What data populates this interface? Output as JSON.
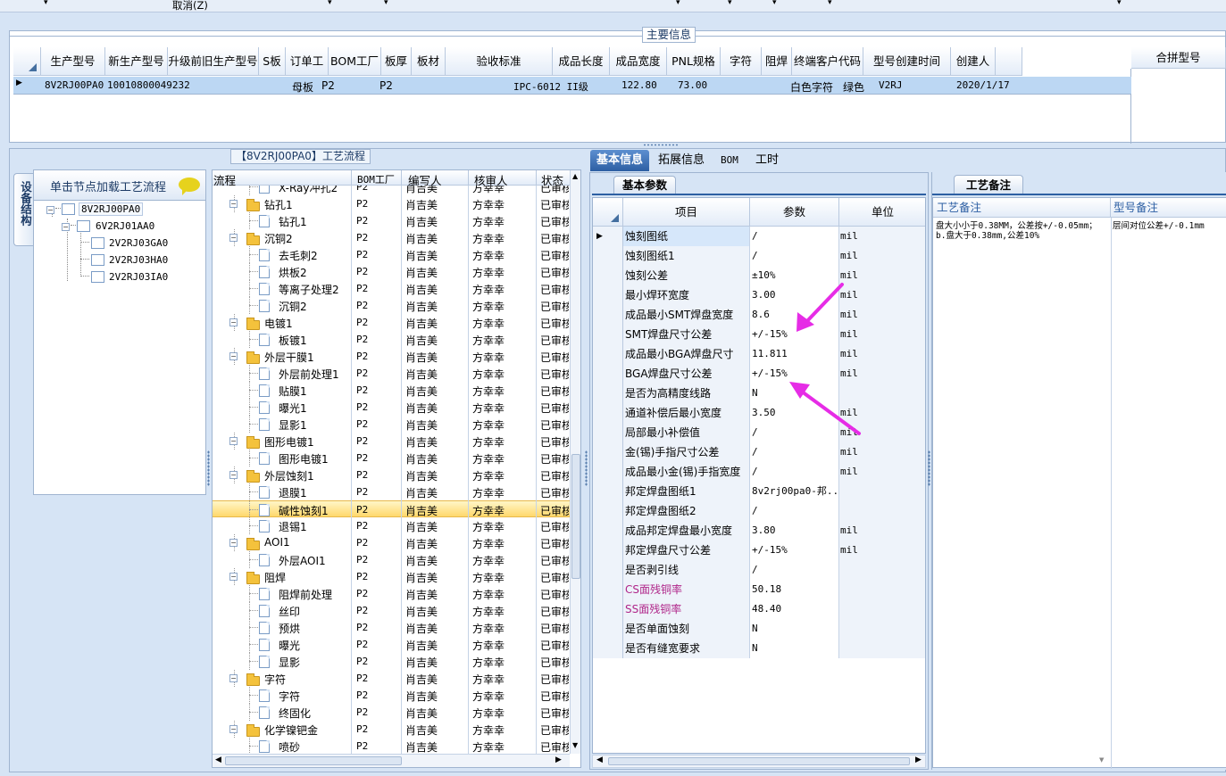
{
  "toolbar": {
    "cancel_label": "取消(Z)"
  },
  "main_info": {
    "title": "主要信息",
    "columns": [
      "生产型号",
      "新生产型号",
      "升级前旧生产型号",
      "S板",
      "订单工厂",
      "BOM工厂",
      "板厚",
      "板材",
      "验收标准",
      "成品长度",
      "成品宽度",
      "PNL规格",
      "字符",
      "阻焊",
      "终端客户代码",
      "型号创建时间",
      "创建人"
    ],
    "merge_col": "合拼型号",
    "row": {
      "prod_no": "8V2RJ00PA0",
      "new_prod_no": "10010800049232",
      "s_board": "母板",
      "order_factory": "P2",
      "bom_factory": "P2",
      "standard": "IPC-6012 II级",
      "length": "122.80",
      "width": "73.00",
      "char": "白色字符",
      "solder": "绿色",
      "customer": "V2RJ",
      "created": "2020/1/17"
    }
  },
  "device_panel": {
    "side_tab": "设备结构",
    "title": "单击节点加载工艺流程",
    "nodes": [
      "8V2RJ00PA0",
      "6V2RJ01AA0",
      "2V2RJ03GA0",
      "2V2RJ03HA0",
      "2V2RJ03IA0"
    ]
  },
  "process": {
    "title": "【8V2RJ00PA0】工艺流程",
    "columns": [
      "流程",
      "BOM工厂",
      "编写人",
      "核审人",
      "状态"
    ],
    "rows": [
      {
        "type": "doc",
        "name": "X-Ray冲孔2",
        "bom": "P2",
        "writer": "肖吉美",
        "reviewer": "方幸幸",
        "status": "已审核"
      },
      {
        "type": "folder",
        "name": "钻孔1",
        "bom": "P2",
        "writer": "肖吉美",
        "reviewer": "方幸幸",
        "status": "已审核"
      },
      {
        "type": "doc",
        "name": "钻孔1",
        "bom": "P2",
        "writer": "肖吉美",
        "reviewer": "方幸幸",
        "status": "已审核"
      },
      {
        "type": "folder",
        "name": "沉铜2",
        "bom": "P2",
        "writer": "肖吉美",
        "reviewer": "方幸幸",
        "status": "已审核"
      },
      {
        "type": "doc",
        "name": "去毛刺2",
        "bom": "P2",
        "writer": "肖吉美",
        "reviewer": "方幸幸",
        "status": "已审核"
      },
      {
        "type": "doc",
        "name": "烘板2",
        "bom": "P2",
        "writer": "肖吉美",
        "reviewer": "方幸幸",
        "status": "已审核"
      },
      {
        "type": "doc",
        "name": "等离子处理2",
        "bom": "P2",
        "writer": "肖吉美",
        "reviewer": "方幸幸",
        "status": "已审核"
      },
      {
        "type": "doc",
        "name": "沉铜2",
        "bom": "P2",
        "writer": "肖吉美",
        "reviewer": "方幸幸",
        "status": "已审核"
      },
      {
        "type": "folder",
        "name": "电镀1",
        "bom": "P2",
        "writer": "肖吉美",
        "reviewer": "方幸幸",
        "status": "已审核"
      },
      {
        "type": "doc",
        "name": "板镀1",
        "bom": "P2",
        "writer": "肖吉美",
        "reviewer": "方幸幸",
        "status": "已审核"
      },
      {
        "type": "folder",
        "name": "外层干膜1",
        "bom": "P2",
        "writer": "肖吉美",
        "reviewer": "方幸幸",
        "status": "已审核"
      },
      {
        "type": "doc",
        "name": "外层前处理1",
        "bom": "P2",
        "writer": "肖吉美",
        "reviewer": "方幸幸",
        "status": "已审核"
      },
      {
        "type": "doc",
        "name": "贴膜1",
        "bom": "P2",
        "writer": "肖吉美",
        "reviewer": "方幸幸",
        "status": "已审核"
      },
      {
        "type": "doc",
        "name": "曝光1",
        "bom": "P2",
        "writer": "肖吉美",
        "reviewer": "方幸幸",
        "status": "已审核"
      },
      {
        "type": "doc",
        "name": "显影1",
        "bom": "P2",
        "writer": "肖吉美",
        "reviewer": "方幸幸",
        "status": "已审核"
      },
      {
        "type": "folder",
        "name": "图形电镀1",
        "bom": "P2",
        "writer": "肖吉美",
        "reviewer": "方幸幸",
        "status": "已审核"
      },
      {
        "type": "doc",
        "name": "图形电镀1",
        "bom": "P2",
        "writer": "肖吉美",
        "reviewer": "方幸幸",
        "status": "已审核"
      },
      {
        "type": "folder",
        "name": "外层蚀刻1",
        "bom": "P2",
        "writer": "肖吉美",
        "reviewer": "方幸幸",
        "status": "已审核"
      },
      {
        "type": "doc",
        "name": "退膜1",
        "bom": "P2",
        "writer": "肖吉美",
        "reviewer": "方幸幸",
        "status": "已审核"
      },
      {
        "type": "doc",
        "name": "碱性蚀刻1",
        "bom": "P2",
        "writer": "肖吉美",
        "reviewer": "方幸幸",
        "status": "已审核",
        "selected": true
      },
      {
        "type": "doc",
        "name": "退锡1",
        "bom": "P2",
        "writer": "肖吉美",
        "reviewer": "方幸幸",
        "status": "已审核"
      },
      {
        "type": "folder",
        "name": "AOI1",
        "bom": "P2",
        "writer": "肖吉美",
        "reviewer": "方幸幸",
        "status": "已审核"
      },
      {
        "type": "doc",
        "name": "外层AOI1",
        "bom": "P2",
        "writer": "肖吉美",
        "reviewer": "方幸幸",
        "status": "已审核"
      },
      {
        "type": "folder",
        "name": "阻焊",
        "bom": "P2",
        "writer": "肖吉美",
        "reviewer": "方幸幸",
        "status": "已审核"
      },
      {
        "type": "doc",
        "name": "阻焊前处理",
        "bom": "P2",
        "writer": "肖吉美",
        "reviewer": "方幸幸",
        "status": "已审核"
      },
      {
        "type": "doc",
        "name": "丝印",
        "bom": "P2",
        "writer": "肖吉美",
        "reviewer": "方幸幸",
        "status": "已审核"
      },
      {
        "type": "doc",
        "name": "预烘",
        "bom": "P2",
        "writer": "肖吉美",
        "reviewer": "方幸幸",
        "status": "已审核"
      },
      {
        "type": "doc",
        "name": "曝光",
        "bom": "P2",
        "writer": "肖吉美",
        "reviewer": "方幸幸",
        "status": "已审核"
      },
      {
        "type": "doc",
        "name": "显影",
        "bom": "P2",
        "writer": "肖吉美",
        "reviewer": "方幸幸",
        "status": "已审核"
      },
      {
        "type": "folder",
        "name": "字符",
        "bom": "P2",
        "writer": "肖吉美",
        "reviewer": "方幸幸",
        "status": "已审核"
      },
      {
        "type": "doc",
        "name": "字符",
        "bom": "P2",
        "writer": "肖吉美",
        "reviewer": "方幸幸",
        "status": "已审核"
      },
      {
        "type": "doc",
        "name": "终固化",
        "bom": "P2",
        "writer": "肖吉美",
        "reviewer": "方幸幸",
        "status": "已审核"
      },
      {
        "type": "folder",
        "name": "化学镍钯金",
        "bom": "P2",
        "writer": "肖吉美",
        "reviewer": "方幸幸",
        "status": "已审核"
      },
      {
        "type": "doc",
        "name": "喷砂",
        "bom": "P2",
        "writer": "肖吉美",
        "reviewer": "方幸幸",
        "status": "已审核"
      }
    ]
  },
  "detail": {
    "tabs": [
      "基本信息",
      "拓展信息",
      "BOM",
      "工时"
    ],
    "subtab": "基本参数",
    "columns": [
      "项目",
      "参数",
      "单位"
    ],
    "rows": [
      {
        "item": "蚀刻图纸",
        "param": "/",
        "unit": "mil"
      },
      {
        "item": "蚀刻图纸1",
        "param": "/",
        "unit": "mil"
      },
      {
        "item": "蚀刻公差",
        "param": "±10%",
        "unit": "mil"
      },
      {
        "item": "最小焊环宽度",
        "param": "3.00",
        "unit": "mil"
      },
      {
        "item": "成品最小SMT焊盘宽度",
        "param": "8.6",
        "unit": "mil"
      },
      {
        "item": "SMT焊盘尺寸公差",
        "param": "+/-15%",
        "unit": "mil"
      },
      {
        "item": "成品最小BGA焊盘尺寸",
        "param": "11.811",
        "unit": "mil"
      },
      {
        "item": "BGA焊盘尺寸公差",
        "param": "+/-15%",
        "unit": "mil"
      },
      {
        "item": "是否为高精度线路",
        "param": "N",
        "unit": ""
      },
      {
        "item": "通道补偿后最小宽度",
        "param": "3.50",
        "unit": "mil"
      },
      {
        "item": "局部最小补偿值",
        "param": "/",
        "unit": "mil"
      },
      {
        "item": "金(锡)手指尺寸公差",
        "param": "/",
        "unit": "mil"
      },
      {
        "item": "成品最小金(锡)手指宽度",
        "param": "/",
        "unit": "mil"
      },
      {
        "item": "邦定焊盘图纸1",
        "param": "8v2rj00pa0-邦...",
        "unit": ""
      },
      {
        "item": "邦定焊盘图纸2",
        "param": "/",
        "unit": ""
      },
      {
        "item": "成品邦定焊盘最小宽度",
        "param": "3.80",
        "unit": "mil"
      },
      {
        "item": "邦定焊盘尺寸公差",
        "param": "+/-15%",
        "unit": "mil"
      },
      {
        "item": "是否剥引线",
        "param": "/",
        "unit": ""
      },
      {
        "item": "CS面残铜率",
        "param": "50.18",
        "unit": "",
        "highlight": true
      },
      {
        "item": "SS面残铜率",
        "param": "48.40",
        "unit": "",
        "highlight": true
      },
      {
        "item": "是否单面蚀刻",
        "param": "N",
        "unit": ""
      },
      {
        "item": "是否有缝宽要求",
        "param": "N",
        "unit": ""
      }
    ]
  },
  "remarks": {
    "tab": "工艺备注",
    "col1": "工艺备注",
    "col2": "型号备注",
    "text1": "盘大小小于0.38MM，公差按+/-0.05mm；b.盘大于0.38mm,公差10%",
    "text2": "层间对位公差+/-0.1mm"
  },
  "colors": {
    "accent": "#3d6fb0",
    "selected_row": "#bcd7f3",
    "arrow": "#e62ce6",
    "highlight_text": "#b0278a"
  }
}
